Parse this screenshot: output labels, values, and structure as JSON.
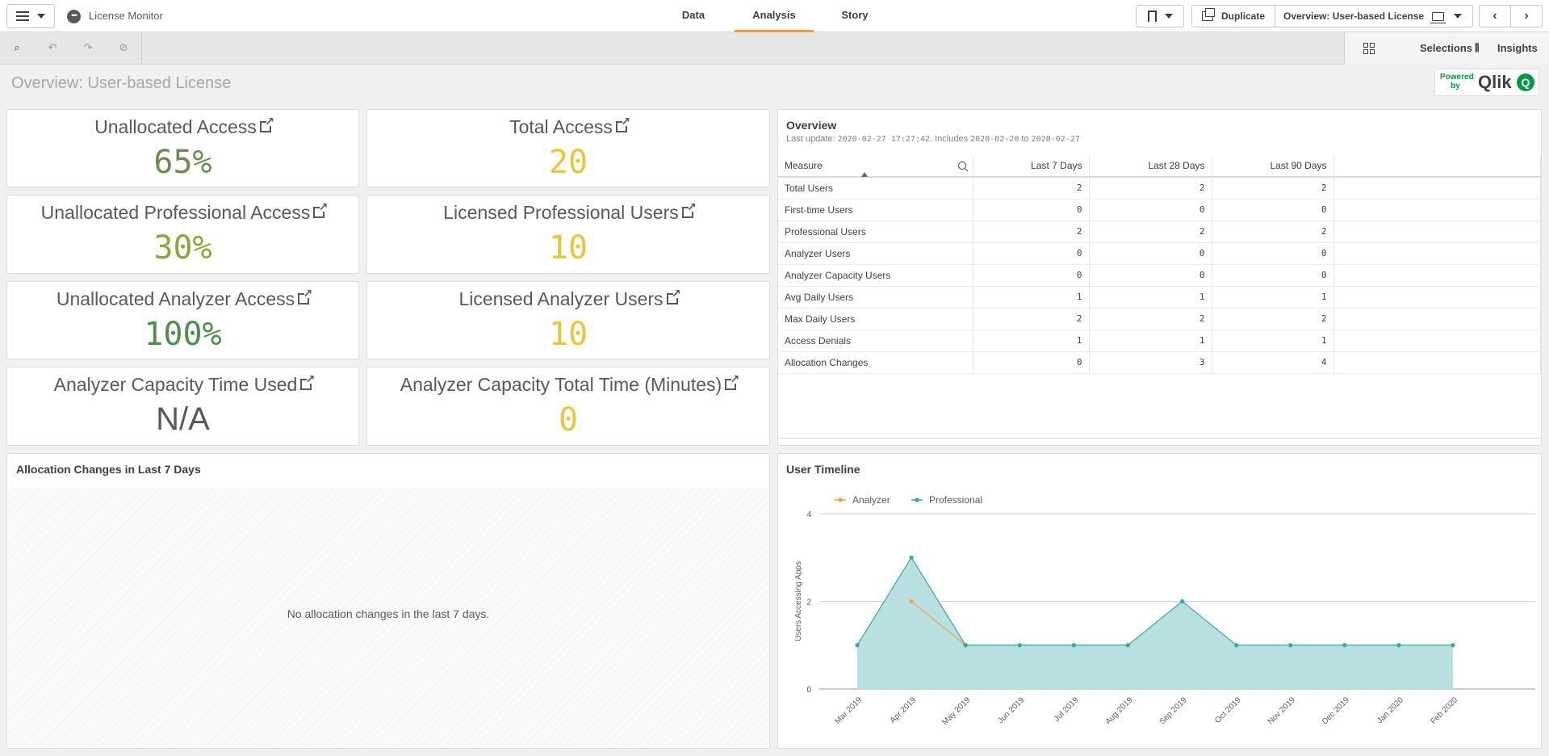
{
  "header": {
    "app_title": "License Monitor",
    "tabs": [
      {
        "label": "Data",
        "active": false
      },
      {
        "label": "Analysis",
        "active": true
      },
      {
        "label": "Story",
        "active": false
      }
    ],
    "duplicate_label": "Duplicate",
    "sheet_select_label": "Overview: User-based License"
  },
  "toolbar": {
    "selections_label": "Selections",
    "insights_label": "Insights"
  },
  "sheet": {
    "title": "Overview: User-based License",
    "powered_by": "Powered by",
    "qlik_logo_text": "Qlik"
  },
  "kpis": [
    {
      "title": "Unallocated Access",
      "value": "65%",
      "color": "#6b8e4e"
    },
    {
      "title": "Total Access",
      "value": "20",
      "color": "#e8c53a"
    },
    {
      "title": "Unallocated Professional Access",
      "value": "30%",
      "color": "#8aa63c"
    },
    {
      "title": "Licensed Professional Users",
      "value": "10",
      "color": "#e8c53a"
    },
    {
      "title": "Unallocated Analyzer Access",
      "value": "100%",
      "color": "#4e8e4e"
    },
    {
      "title": "Licensed Analyzer Users",
      "value": "10",
      "color": "#e8c53a"
    },
    {
      "title": "Analyzer Capacity Time Used",
      "value": "N/A",
      "color": "#595959"
    },
    {
      "title": "Analyzer Capacity Total Time (Minutes)",
      "value": "0",
      "color": "#e8c53a"
    }
  ],
  "overview": {
    "title": "Overview",
    "subtitle_prefix": "Last update: ",
    "last_update": "2020-02-27 17:27:42",
    "subtitle_mid": ". Includes ",
    "range_from": "2020-02-20",
    "subtitle_to": " to ",
    "range_to": "2020-02-27",
    "columns": [
      "Measure",
      "Last 7 Days",
      "Last 28 Days",
      "Last 90 Days"
    ],
    "rows": [
      [
        "Total Users",
        "2",
        "2",
        "2"
      ],
      [
        "First-time Users",
        "0",
        "0",
        "0"
      ],
      [
        "Professional Users",
        "2",
        "2",
        "2"
      ],
      [
        "Analyzer Users",
        "0",
        "0",
        "0"
      ],
      [
        "Analyzer Capacity Users",
        "0",
        "0",
        "0"
      ],
      [
        "Avg Daily Users",
        "1",
        "1",
        "1"
      ],
      [
        "Max Daily Users",
        "2",
        "2",
        "2"
      ],
      [
        "Access Denials",
        "1",
        "1",
        "1"
      ],
      [
        "Allocation Changes",
        "0",
        "3",
        "4"
      ]
    ]
  },
  "allocation": {
    "title": "Allocation Changes in Last 7 Days",
    "empty_message": "No allocation changes in the last 7 days."
  },
  "chart_data": {
    "type": "area",
    "title": "User Timeline",
    "xlabel": "",
    "ylabel": "Users Accessing Apps",
    "ylim": [
      0,
      4
    ],
    "yticks": [
      0,
      2,
      4
    ],
    "grid": true,
    "legend_position": "top-left",
    "categories": [
      "Mar 2019",
      "Apr 2019",
      "May 2019",
      "Jun 2019",
      "Jul 2019",
      "Aug 2019",
      "Sep 2019",
      "Oct 2019",
      "Nov 2019",
      "Dec 2019",
      "Jan 2020",
      "Feb 2020"
    ],
    "series": [
      {
        "name": "Analyzer",
        "color": "#f5a142",
        "values": [
          null,
          2,
          1,
          null,
          null,
          null,
          null,
          null,
          null,
          null,
          null,
          null
        ]
      },
      {
        "name": "Professional",
        "color": "#3aa6a6",
        "values": [
          1,
          3,
          1,
          1,
          1,
          1,
          2,
          1,
          1,
          1,
          1,
          1
        ]
      }
    ]
  }
}
